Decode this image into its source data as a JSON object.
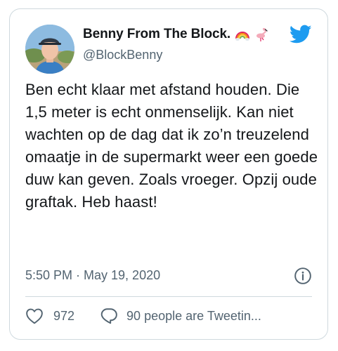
{
  "tweet": {
    "display_name": "Benny From The Block.",
    "handle": "@BlockBenny",
    "name_emojis": [
      "rainbow-emoji",
      "flamingo-emoji"
    ],
    "text": "Ben echt klaar met afstand houden. Die 1,5 meter is echt onmenselijk. Kan niet wachten op de dag dat ik zo’n treuzelend omaatje in de supermarkt weer een goede duw kan geven. Zoals vroeger. Opzij oude graftak. Heb haast!",
    "timestamp": "5:50 PM · May 19, 2020",
    "like_count": "972",
    "conversation_label": "90 people are Tweetin..."
  },
  "colors": {
    "twitter_blue": "#1d9bf0",
    "text_primary": "#14171a",
    "text_secondary": "#536471",
    "border": "#cfd9de"
  },
  "icons": {
    "brand": "twitter-bird-icon",
    "info": "info-icon",
    "like": "heart-icon",
    "reply": "speech-bubble-icon"
  }
}
